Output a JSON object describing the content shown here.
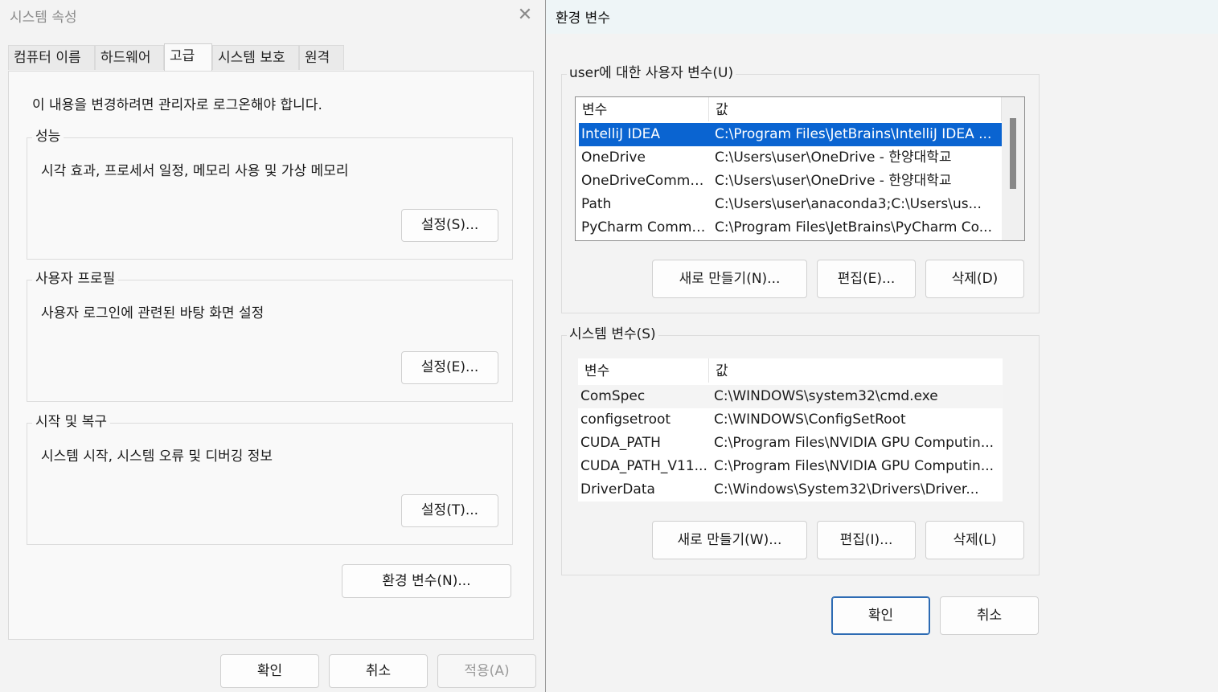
{
  "system_properties": {
    "title": "시스템 속성",
    "tabs": [
      {
        "label": "컴퓨터 이름"
      },
      {
        "label": "하드웨어"
      },
      {
        "label": "고급"
      },
      {
        "label": "시스템 보호"
      },
      {
        "label": "원격"
      }
    ],
    "active_tab": "고급",
    "admin_note": "이 내용을 변경하려면 관리자로 로그온해야 합니다.",
    "performance": {
      "title": "성능",
      "description": "시각 효과, 프로세서 일정, 메모리 사용 및 가상 메모리",
      "button": "설정(S)..."
    },
    "user_profiles": {
      "title": "사용자 프로필",
      "description": "사용자 로그인에 관련된 바탕 화면 설정",
      "button": "설정(E)..."
    },
    "startup_recovery": {
      "title": "시작 및 복구",
      "description": "시스템 시작, 시스템 오류 및 디버깅 정보",
      "button": "설정(T)..."
    },
    "env_button": "환경 변수(N)...",
    "ok": "확인",
    "cancel": "취소",
    "apply": "적용(A)"
  },
  "environment_variables": {
    "title": "환경 변수",
    "user_section": {
      "title": "user에 대한 사용자 변수(U)",
      "col_var": "변수",
      "col_value": "값",
      "rows": [
        {
          "var": "IntelliJ IDEA",
          "value": "C:\\Program Files\\JetBrains\\IntelliJ IDEA ...",
          "selected": true
        },
        {
          "var": "OneDrive",
          "value": "C:\\Users\\user\\OneDrive - 한양대학교"
        },
        {
          "var": "OneDriveCommer...",
          "value": "C:\\Users\\user\\OneDrive - 한양대학교"
        },
        {
          "var": "Path",
          "value": "C:\\Users\\user\\anaconda3;C:\\Users\\us..."
        },
        {
          "var": "PyCharm Commu...",
          "value": "C:\\Program Files\\JetBrains\\PyCharm Co..."
        }
      ],
      "new": "새로 만들기(N)...",
      "edit": "편집(E)...",
      "delete": "삭제(D)"
    },
    "system_section": {
      "title": "시스템 변수(S)",
      "col_var": "변수",
      "col_value": "값",
      "rows": [
        {
          "var": "ComSpec",
          "value": "C:\\WINDOWS\\system32\\cmd.exe"
        },
        {
          "var": "configsetroot",
          "value": "C:\\WINDOWS\\ConfigSetRoot"
        },
        {
          "var": "CUDA_PATH",
          "value": "C:\\Program Files\\NVIDIA GPU Computin..."
        },
        {
          "var": "CUDA_PATH_V11...",
          "value": "C:\\Program Files\\NVIDIA GPU Computin..."
        },
        {
          "var": "DriverData",
          "value": "C:\\Windows\\System32\\Drivers\\Driver..."
        }
      ],
      "new": "새로 만들기(W)...",
      "edit": "편집(I)...",
      "delete": "삭제(L)"
    },
    "ok": "확인",
    "cancel": "취소"
  },
  "colors": {
    "selection": "#0a64d1",
    "primary_border": "#2d6bb3"
  },
  "icons": {
    "close": "close-icon"
  }
}
